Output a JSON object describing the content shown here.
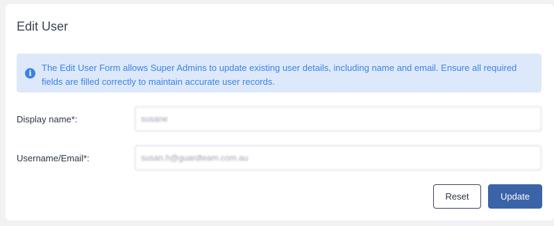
{
  "form": {
    "title": "Edit User",
    "info_icon": "info-icon",
    "info_text": "The Edit User Form allows Super Admins to update existing user details, including name and email. Ensure all required fields are filled correctly to maintain accurate user records.",
    "display_name_label": "Display name*:",
    "display_name_value": "susane",
    "email_label": "Username/Email*:",
    "email_value": "susan.h@guardteam.com.au",
    "reset_label": "Reset",
    "update_label": "Update"
  },
  "colors": {
    "accent": "#3b63a8",
    "info_bg": "#dde9fb",
    "info_text": "#3b82e4"
  }
}
